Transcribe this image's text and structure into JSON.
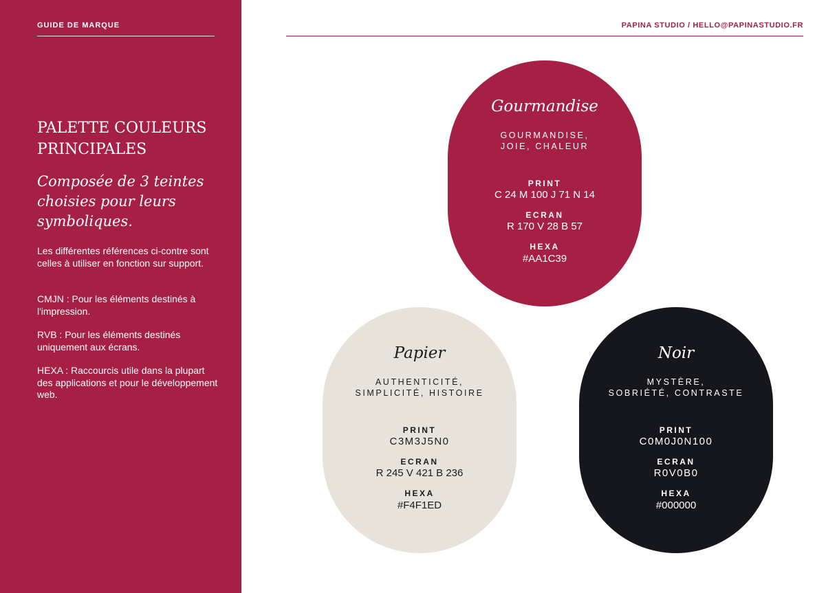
{
  "sidebar": {
    "brand_guide": "GUIDE DE MARQUE",
    "title_line1": "PALETTE COULEURS",
    "title_line2": "PRINCIPALES",
    "subtitle": "Composée de 3 teintes choisies pour leurs symboliques.",
    "paragraphs": [
      "Les différentes références ci-contre sont celles à utiliser en fonction sur support.",
      "CMJN : Pour les éléments destinés à l'impression.",
      "RVB : Pour les éléments destinés uniquement aux écrans.",
      "HEXA  :  Raccourcis utile dans la plupart des applications et pour le développement web."
    ]
  },
  "header": {
    "contact": "PAPINA STUDIO / HELLO@PAPINASTUDIO.FR"
  },
  "labels": {
    "print": "PRINT",
    "ecran": "ECRAN",
    "hexa": "HEXA"
  },
  "swatches": [
    {
      "name": "Gourmandise",
      "meaning_line1": "GOURMANDISE,",
      "meaning_line2": "JOIE, CHALEUR",
      "print": "C 24 M 100 J 71 N 14",
      "ecran": "R 170 V 28 B 57",
      "hexa": "#AA1C39",
      "color": "#a61f45"
    },
    {
      "name": "Papier",
      "meaning_line1": "AUTHENTICITÉ,",
      "meaning_line2": "SIMPLICITÉ, HISTOIRE",
      "print": "C3M3J5N0",
      "ecran": "R 245 V 421 B 236",
      "hexa": "#F4F1ED",
      "color": "#e7e2da"
    },
    {
      "name": "Noir",
      "meaning_line1": "MYSTÈRE,",
      "meaning_line2": "SOBRIÉTÉ, CONTRASTE",
      "print": "C0M0J0N100",
      "ecran": "R0V0B0",
      "hexa": "#000000",
      "color": "#16161d"
    }
  ]
}
